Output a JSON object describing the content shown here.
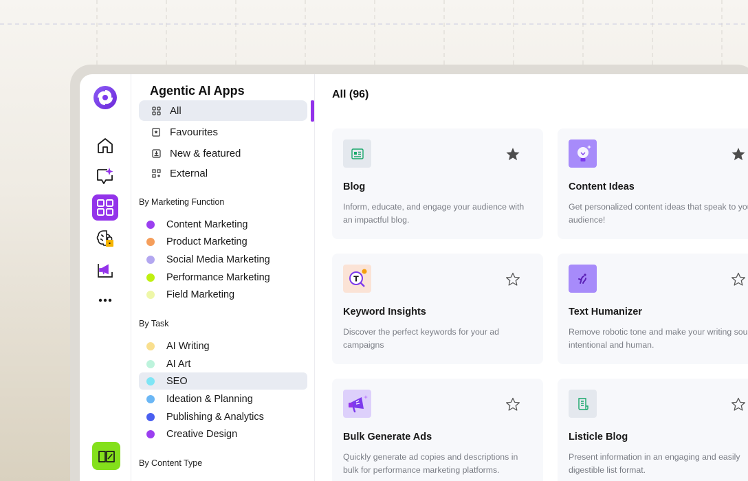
{
  "rail": {
    "items": [
      {
        "icon": "logo-icon"
      },
      {
        "icon": "home-icon"
      },
      {
        "icon": "chat-sparkle-icon"
      },
      {
        "icon": "apps-grid-icon",
        "active": true
      },
      {
        "icon": "brain-lock-icon"
      },
      {
        "icon": "campaign-icon"
      },
      {
        "icon": "more-icon"
      },
      {
        "icon": "book-icon"
      }
    ],
    "accent": "#9333ea",
    "book_color": "#84e01b"
  },
  "sidebar": {
    "title": "Agentic AI Apps",
    "nav": [
      {
        "label": "All",
        "icon": "grid-icon",
        "active": true
      },
      {
        "label": "Favourites",
        "icon": "bookmark-icon"
      },
      {
        "label": "New & featured",
        "icon": "download-box-icon"
      },
      {
        "label": "External",
        "icon": "grid-plus-icon"
      }
    ],
    "marketing_heading": "By Marketing Function",
    "marketing": [
      {
        "label": "Content Marketing",
        "color": "#9b3ff0"
      },
      {
        "label": "Product Marketing",
        "color": "#f59e5b"
      },
      {
        "label": "Social Media Marketing",
        "color": "#b3a7f0"
      },
      {
        "label": "Performance Marketing",
        "color": "#bff010"
      },
      {
        "label": "Field Marketing",
        "color": "#eef7a8"
      }
    ],
    "task_heading": "By Task",
    "tasks": [
      {
        "label": "AI Writing",
        "color": "#f9df8e"
      },
      {
        "label": "AI Art",
        "color": "#bdf3dc"
      },
      {
        "label": "SEO",
        "color": "#7ee5f5",
        "selected": true
      },
      {
        "label": "Ideation & Planning",
        "color": "#6bb7f5"
      },
      {
        "label": "Publishing & Analytics",
        "color": "#4a5ff0"
      },
      {
        "label": "Creative Design",
        "color": "#9b3ff0"
      }
    ],
    "content_type_heading": "By Content Type"
  },
  "main": {
    "title": "All  (96)",
    "cards": [
      {
        "title": "Blog",
        "description": "Inform, educate, and engage your audience with an impactful blog.",
        "icon": "blog-icon",
        "favourite": true
      },
      {
        "title": "Content Ideas",
        "description": "Get personalized content ideas that speak to your audience!",
        "icon": "lightbulb-icon",
        "favourite": true
      },
      {
        "title": "Keyword Insights",
        "description": "Discover the perfect keywords for your ad campaigns",
        "icon": "keyword-search-icon",
        "favourite": false
      },
      {
        "title": "Text Humanizer",
        "description": "Remove robotic tone and make your writing sound intentional and human.",
        "icon": "humanizer-icon",
        "favourite": false
      },
      {
        "title": "Bulk Generate Ads",
        "description": "Quickly generate ad copies and descriptions in bulk for performance marketing platforms.",
        "icon": "megaphone-icon",
        "favourite": false
      },
      {
        "title": "Listicle Blog",
        "description": "Present information in an engaging and easily digestible list format.",
        "icon": "list-doc-icon",
        "favourite": false
      }
    ]
  }
}
